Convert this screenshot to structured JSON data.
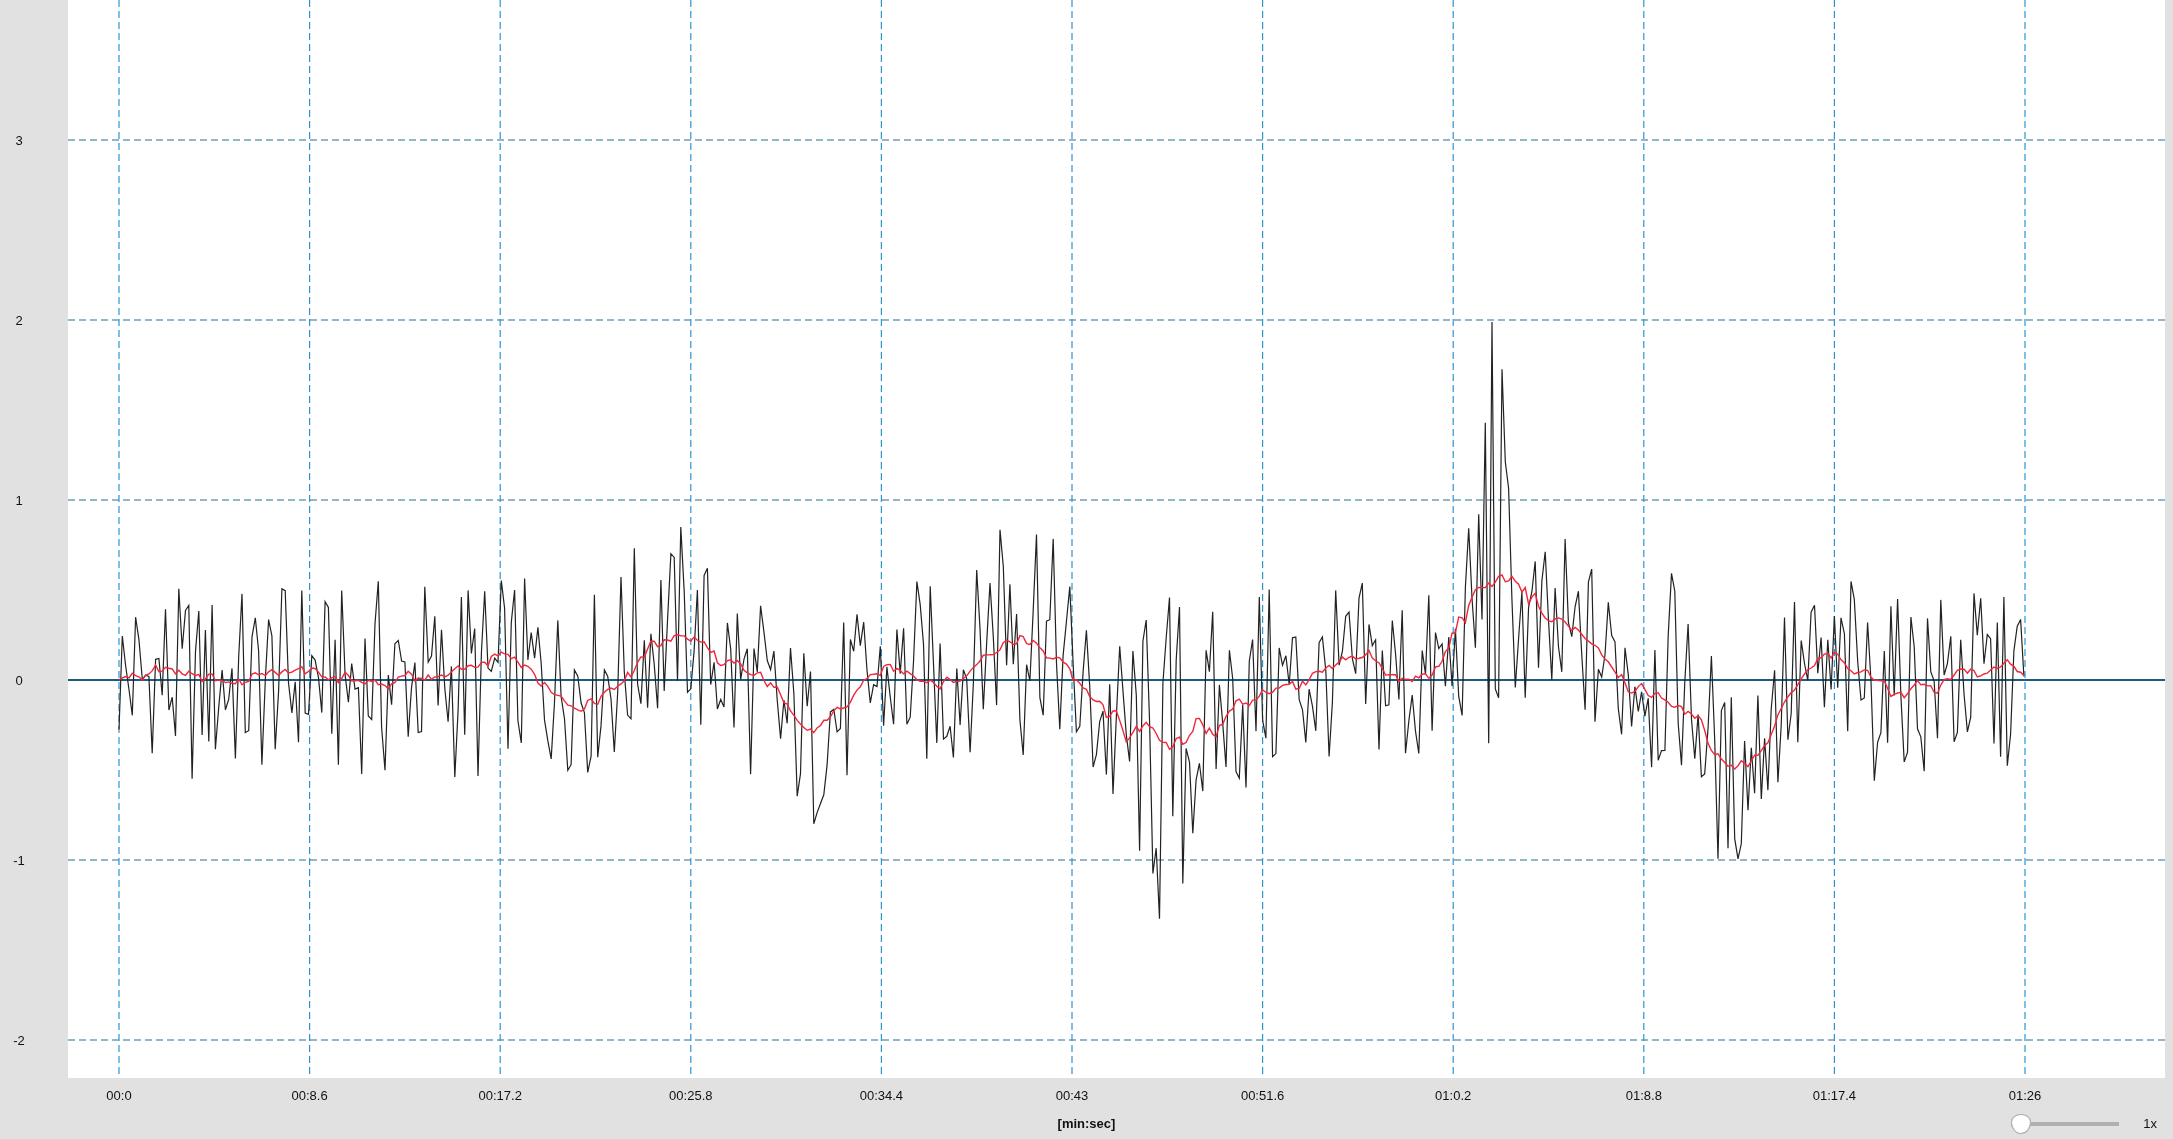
{
  "chart": {
    "yticks": [
      "3",
      "2",
      "1",
      "0",
      "-1",
      "-2"
    ],
    "xticks": [
      "00:0",
      "00:8.6",
      "00:17.2",
      "00:25.8",
      "00:34.4",
      "00:43",
      "00:51.6",
      "01:0.2",
      "01:8.8",
      "01:17.4",
      "01:26"
    ],
    "xlabel": "[min:sec]"
  },
  "zoom": {
    "level": 0,
    "reading": "1x"
  }
}
